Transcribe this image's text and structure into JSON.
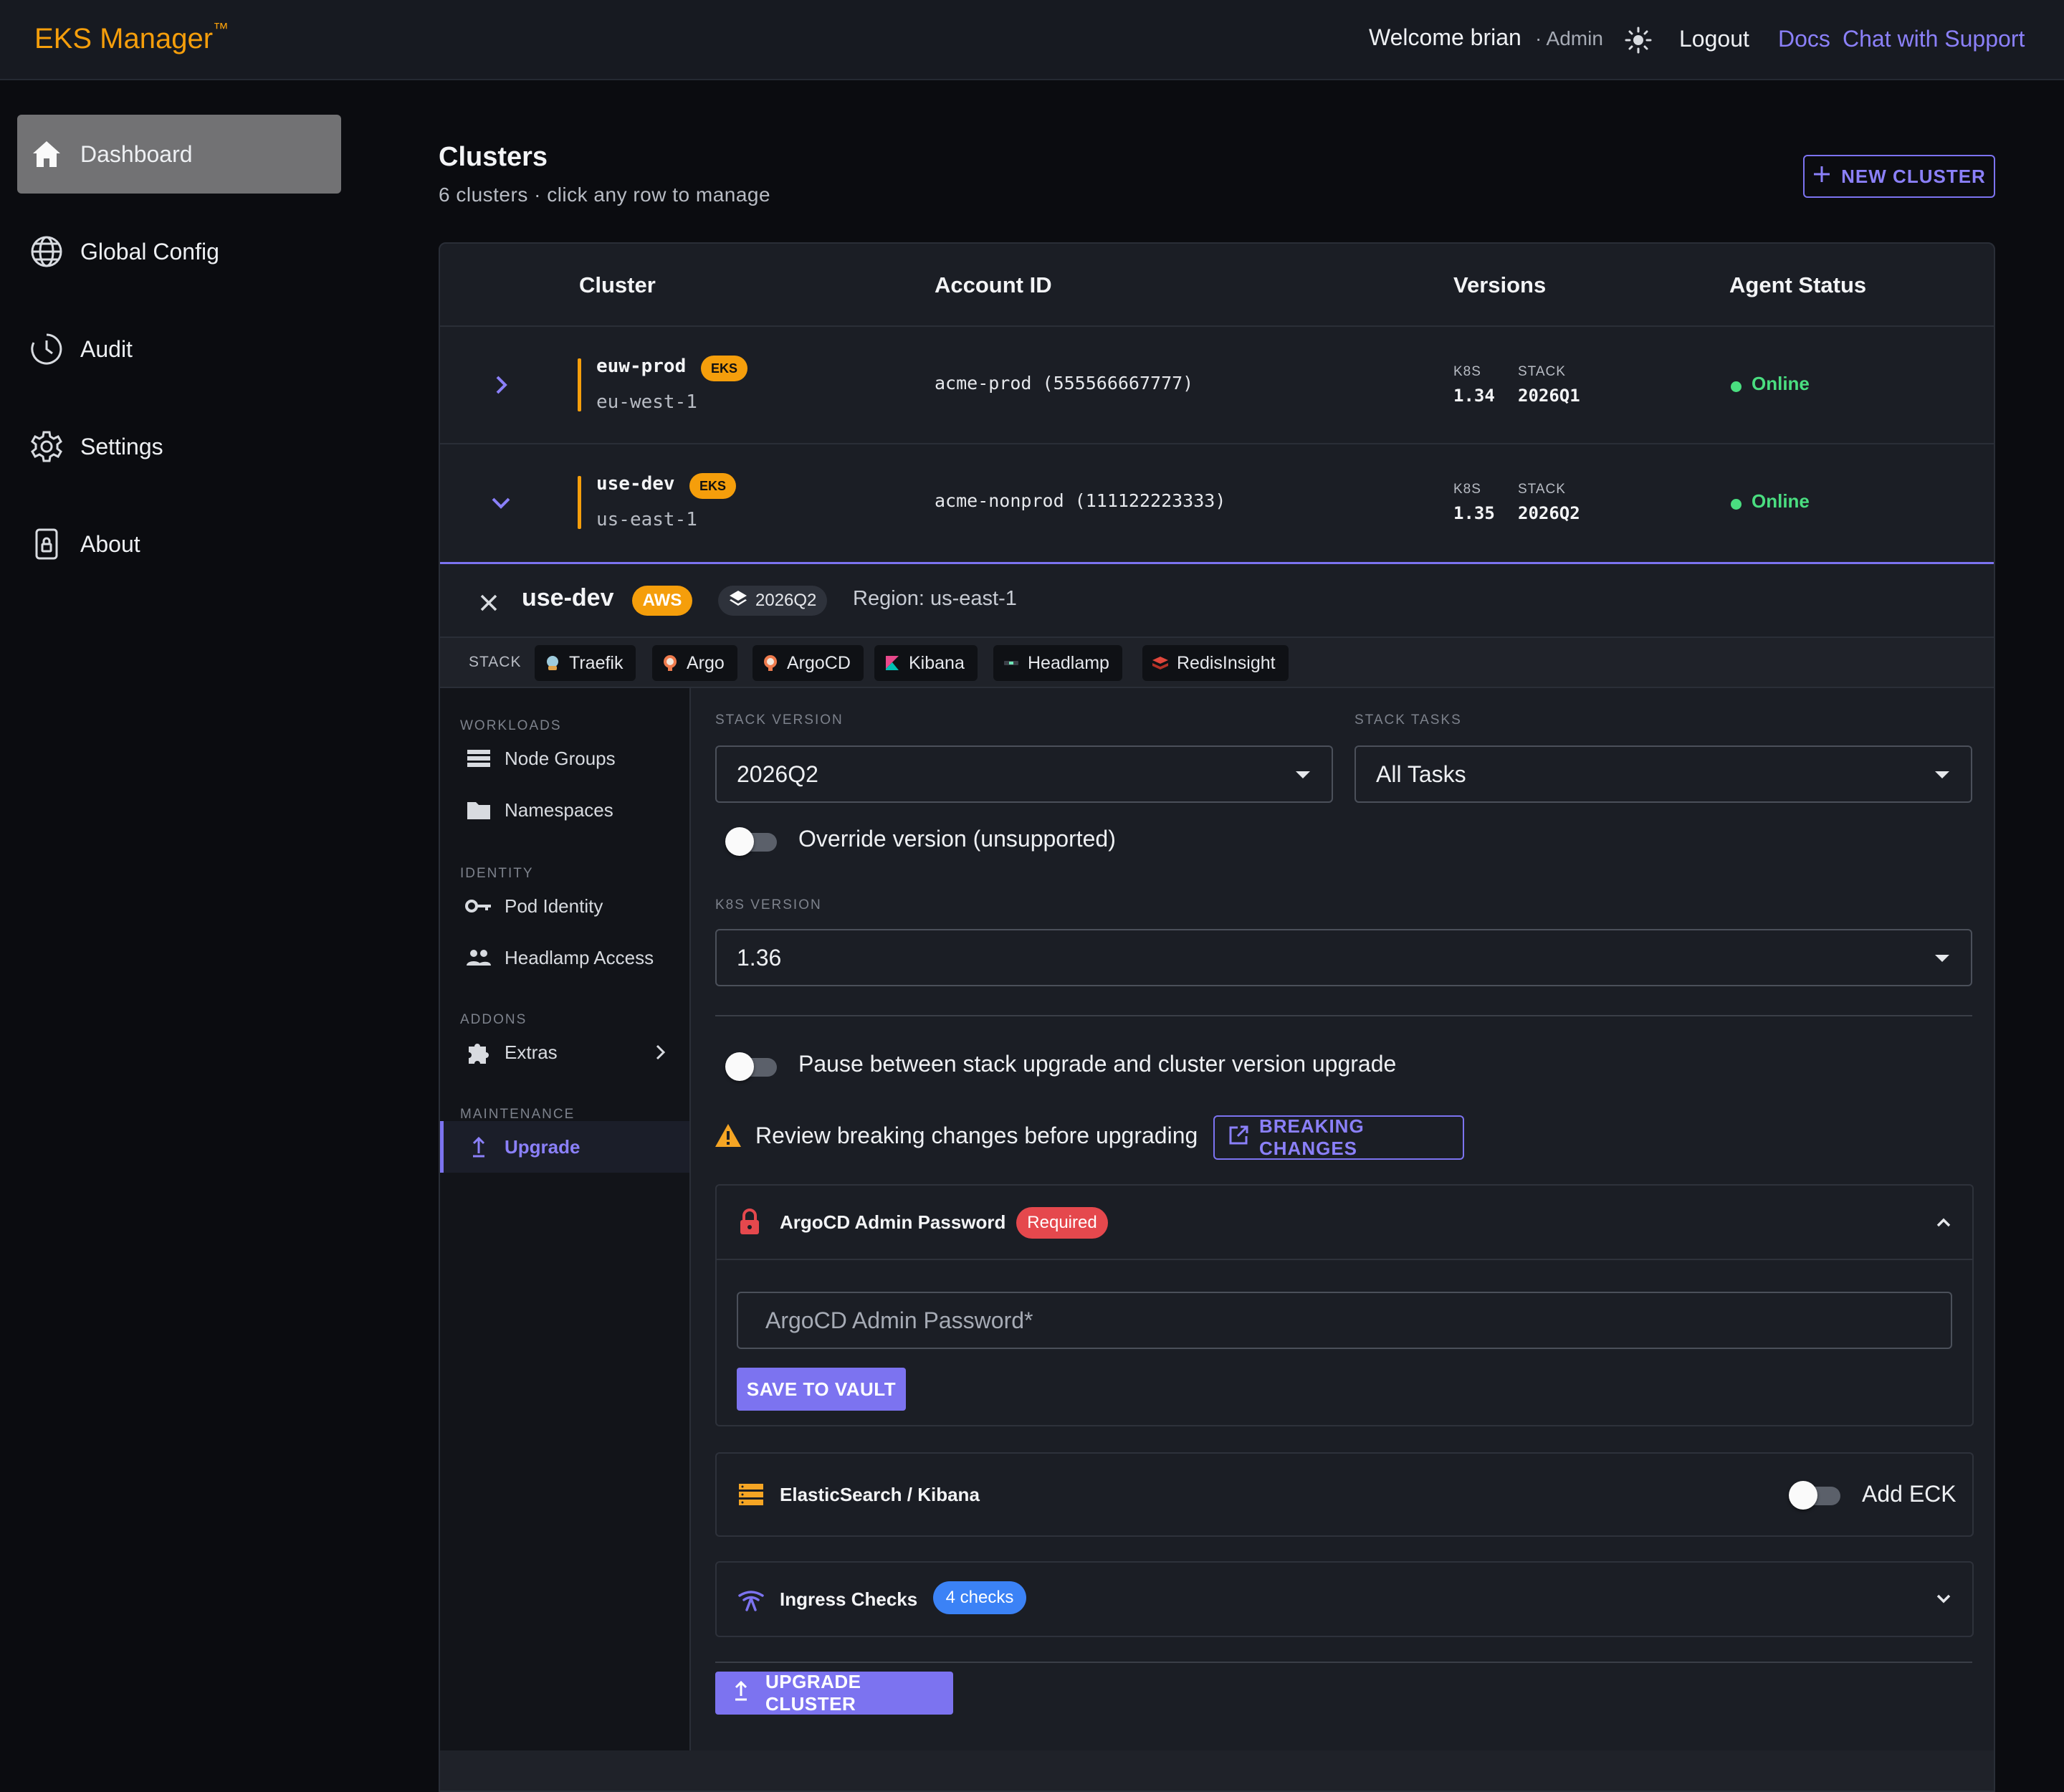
{
  "app": {
    "brand": "EKS Manager",
    "brand_mark": "™"
  },
  "topbar": {
    "welcome": "Welcome brian",
    "role": "· Admin",
    "theme_icon": "sun-icon",
    "logout": "Logout",
    "docs": "Docs",
    "support": "Chat with Support"
  },
  "sidebar": {
    "items": [
      {
        "label": "Dashboard",
        "icon": "home-icon",
        "active": true
      },
      {
        "label": "Global Config",
        "icon": "globe-icon"
      },
      {
        "label": "Audit",
        "icon": "clock-icon"
      },
      {
        "label": "Settings",
        "icon": "gear-icon"
      },
      {
        "label": "About",
        "icon": "lock-icon"
      }
    ]
  },
  "page": {
    "title": "Clusters",
    "subtitle": "6 clusters · click any row to manage",
    "new_cluster": "NEW CLUSTER"
  },
  "table": {
    "headers": [
      "Cluster",
      "Account ID",
      "Versions",
      "Agent Status"
    ],
    "rows": [
      {
        "name": "euw-prod",
        "badge": "EKS",
        "region": "eu-west-1",
        "account": "acme-prod (555566667777)",
        "k8s_label": "K8S",
        "k8s": "1.34",
        "stack_label": "STACK",
        "stack": "2026Q1",
        "status": "Online",
        "expanded": false
      },
      {
        "name": "use-dev",
        "badge": "EKS",
        "region": "us-east-1",
        "account": "acme-nonprod (111122223333)",
        "k8s_label": "K8S",
        "k8s": "1.35",
        "stack_label": "STACK",
        "stack": "2026Q2",
        "status": "Online",
        "expanded": true
      }
    ]
  },
  "detail": {
    "name": "use-dev",
    "provider": "AWS",
    "version_chip": "2026Q2",
    "region": "Region: us-east-1",
    "stack_label": "STACK",
    "stack": [
      "Traefik",
      "Argo",
      "ArgoCD",
      "Kibana",
      "Headlamp",
      "RedisInsight"
    ],
    "nav": {
      "workloads": "WORKLOADS",
      "node_groups": "Node Groups",
      "namespaces": "Namespaces",
      "identity": "IDENTITY",
      "pod_identity": "Pod Identity",
      "headlamp_access": "Headlamp Access",
      "addons": "ADDONS",
      "extras": "Extras",
      "maintenance": "MAINTENANCE",
      "upgrade": "Upgrade"
    },
    "upgrade": {
      "stack_version_label": "STACK VERSION",
      "stack_version": "2026Q2",
      "stack_tasks_label": "STACK TASKS",
      "stack_tasks": "All Tasks",
      "override_label": "Override version (unsupported)",
      "override_on": false,
      "k8s_version_label": "K8S VERSION",
      "k8s_version": "1.36",
      "pause_label": "Pause between stack upgrade and cluster version upgrade",
      "pause_on": false,
      "warning": "Review breaking changes before upgrading",
      "breaking_btn": "BREAKING CHANGES",
      "argocd": {
        "title": "ArgoCD Admin Password",
        "badge": "Required",
        "placeholder": "ArgoCD Admin Password*",
        "save": "SAVE TO VAULT"
      },
      "eck": {
        "title": "ElasticSearch / Kibana",
        "toggle_label": "Add ECK",
        "on": false
      },
      "ingress": {
        "title": "Ingress Checks",
        "badge": "4 checks"
      },
      "upgrade_btn": "UPGRADE CLUSTER"
    }
  },
  "colors": {
    "accent": "#7c73f0",
    "brand": "#f59e0b",
    "online": "#4ade80",
    "required": "#e5484d",
    "info": "#3b82f6"
  }
}
